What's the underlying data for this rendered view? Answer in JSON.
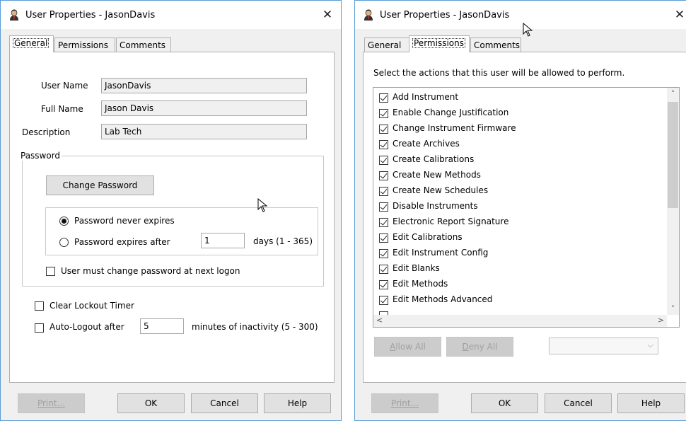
{
  "left_dialog": {
    "title": "User Properties - JasonDavis",
    "tabs": [
      "General",
      "Permissions",
      "Comments"
    ],
    "fields": {
      "user_name_label": "User Name",
      "user_name_value": "JasonDavis",
      "full_name_label": "Full Name",
      "full_name_value": "Jason Davis",
      "description_label": "Description",
      "description_value": "Lab Tech"
    },
    "password_group": {
      "title": "Password",
      "change_button": "Change Password",
      "never_expires": "Password never expires",
      "expires_after": "Password expires after",
      "expire_days": "1",
      "days_range": "days (1 - 365)",
      "must_change": "User must change password at next logon"
    },
    "clear_lockout": "Clear Lockout Timer",
    "auto_logout": "Auto-Logout after",
    "auto_logout_value": "5",
    "inactivity_text": "minutes of inactivity (5 - 300)",
    "buttons": {
      "print": "Print...",
      "ok": "OK",
      "cancel": "Cancel",
      "help": "Help"
    }
  },
  "right_dialog": {
    "title": "User Properties - JasonDavis",
    "tabs": [
      "General",
      "Permissions",
      "Comments"
    ],
    "instruction": "Select the actions that this user will be allowed to perform.",
    "permissions": [
      "Add Instrument",
      "Enable Change Justification",
      "Change Instrument Firmware",
      "Create Archives",
      "Create Calibrations",
      "Create New Methods",
      "Create New Schedules",
      "Disable Instruments",
      "Electronic Report Signature",
      "Edit Calibrations",
      "Edit Instrument Config",
      "Edit Blanks",
      "Edit Methods",
      "Edit Methods Advanced"
    ],
    "allow_all": "Allow All",
    "deny_all": "Deny All",
    "buttons": {
      "print": "Print...",
      "ok": "OK",
      "cancel": "Cancel",
      "help": "Help"
    }
  },
  "icons": {
    "app": "user-properties-icon",
    "close": "close-icon",
    "cursor": "mouse-pointer-icon"
  }
}
